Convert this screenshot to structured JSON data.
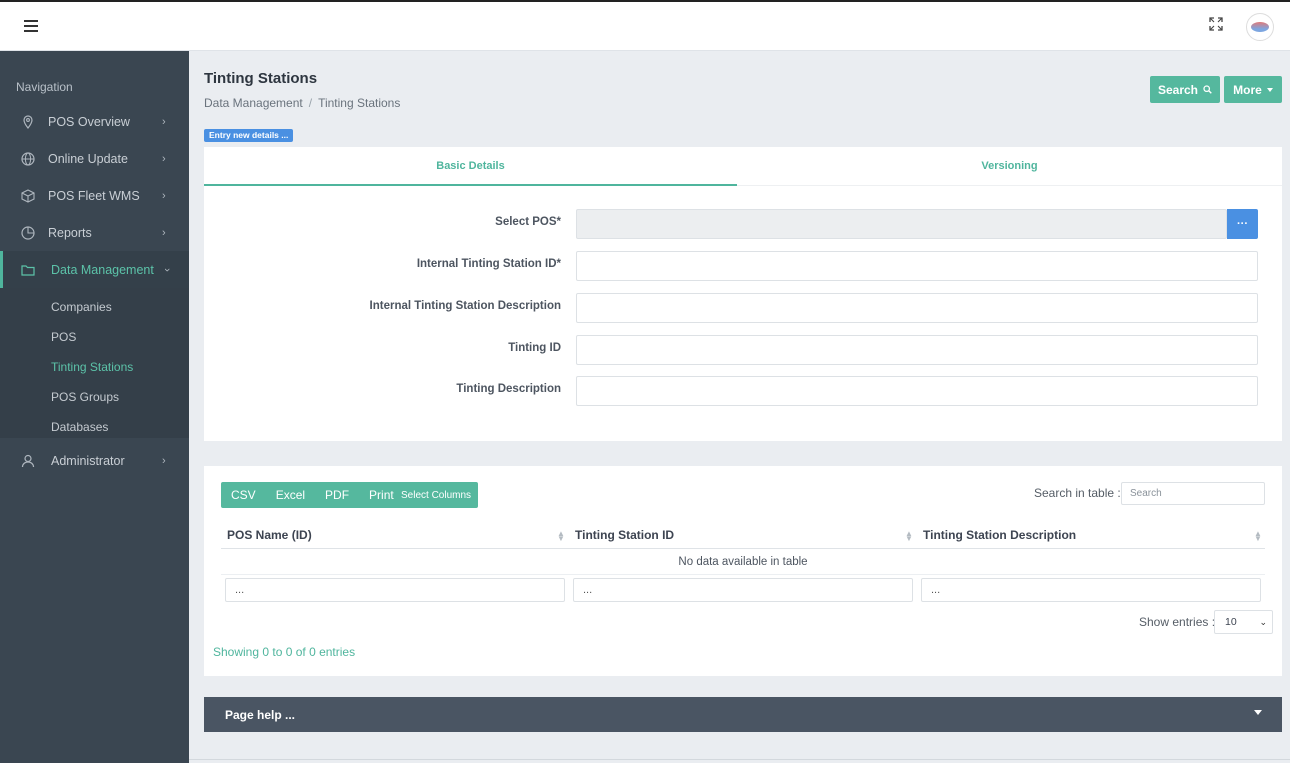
{
  "header": {
    "menu_icon": "hamburger-icon",
    "fullscreen_icon": "fullscreen-icon",
    "avatar_icon": "avatar"
  },
  "sidebar": {
    "title": "Navigation",
    "items": [
      {
        "label": "POS Overview",
        "icon": "map-pin-icon"
      },
      {
        "label": "Online Update",
        "icon": "globe-icon"
      },
      {
        "label": "POS Fleet WMS",
        "icon": "box-icon"
      },
      {
        "label": "Reports",
        "icon": "pie-chart-icon"
      },
      {
        "label": "Data Management",
        "icon": "folder-icon",
        "active": true
      },
      {
        "label": "Administrator",
        "icon": "user-icon"
      }
    ],
    "subitems": [
      "Companies",
      "POS",
      "Tinting Stations",
      "POS Groups",
      "Databases"
    ],
    "current_subitem": "Tinting Stations"
  },
  "page": {
    "title": "Tinting Stations",
    "breadcrumb": [
      "Data Management",
      "Tinting Stations"
    ],
    "breadcrumb_sep": "/",
    "search_label": "Search",
    "more_label": "More",
    "entry_badge": "Entry new details ..."
  },
  "form": {
    "tabs": [
      "Basic Details",
      "Versioning"
    ],
    "active_tab": "Basic Details",
    "fields": [
      {
        "label": "Select POS*",
        "value": ""
      },
      {
        "label": "Internal Tinting Station ID*",
        "value": ""
      },
      {
        "label": "Internal Tinting Station Description",
        "value": ""
      },
      {
        "label": "Tinting ID",
        "value": ""
      },
      {
        "label": "Tinting Description",
        "value": ""
      }
    ],
    "picker_label": "···"
  },
  "table": {
    "export_buttons": [
      "CSV",
      "Excel",
      "PDF",
      "Print"
    ],
    "select_columns": "Select Columns",
    "search_label": "Search in table :",
    "search_placeholder": "Search",
    "columns": [
      "POS Name (ID)",
      "Tinting Station ID",
      "Tinting Station Description"
    ],
    "empty_message": "No data available in table",
    "filters": [
      "...",
      "...",
      "..."
    ],
    "show_entries_label": "Show entries :",
    "show_entries_value": "10",
    "showing": "Showing 0 to 0 of 0 entries"
  },
  "help": {
    "title": "Page help ..."
  },
  "colors": {
    "accent": "#55b89e",
    "accent_text": "#4fb59d",
    "sidebar_bg": "#3a4651",
    "blue": "#4a90e2",
    "help_bg": "#4a5563"
  }
}
